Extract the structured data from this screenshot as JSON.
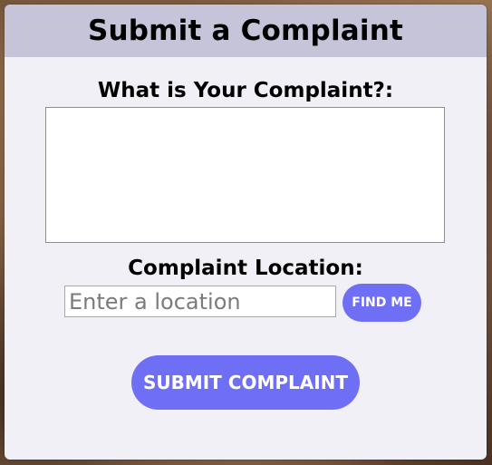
{
  "form": {
    "title": "Submit a Complaint",
    "complaint_label": "What is Your Complaint?:",
    "complaint_value": "",
    "location_label": "Complaint Location:",
    "location_placeholder": "Enter a location",
    "location_value": "",
    "find_me_label": "FIND ME",
    "submit_label": "SUBMIT COMPLAINT"
  },
  "colors": {
    "header_bg": "#c5c4d9",
    "card_bg": "#f1f0f6",
    "button_bg": "#6f6ff5"
  }
}
